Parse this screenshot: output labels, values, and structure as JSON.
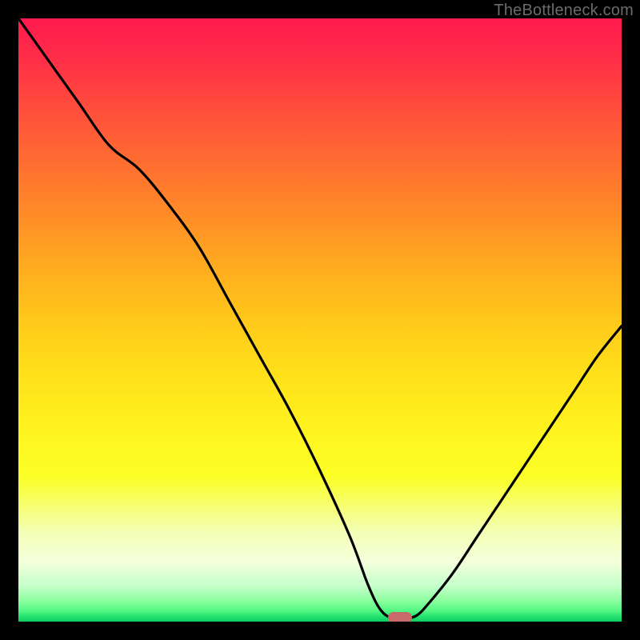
{
  "watermark": "TheBottleneck.com",
  "marker": {
    "x_pct": 63.2,
    "y_pct": 99.3,
    "color": "#c96a6a"
  },
  "chart_data": {
    "type": "line",
    "title": "",
    "xlabel": "",
    "ylabel": "",
    "xlim": [
      0,
      100
    ],
    "ylim": [
      0,
      100
    ],
    "grid": false,
    "series": [
      {
        "name": "bottleneck-curve",
        "x": [
          0,
          5,
          10,
          15,
          20,
          25,
          30,
          35,
          40,
          45,
          50,
          55,
          58,
          60,
          62,
          64,
          66,
          68,
          72,
          76,
          80,
          84,
          88,
          92,
          96,
          100
        ],
        "y": [
          100,
          93,
          86,
          79,
          75,
          69,
          62,
          53,
          44,
          35,
          25,
          14,
          6,
          2,
          0.5,
          0.5,
          1,
          3,
          8,
          14,
          20,
          26,
          32,
          38,
          44,
          49
        ]
      }
    ],
    "annotations": [
      {
        "type": "marker",
        "x": 63.2,
        "y": 0.7,
        "label": "optimal-point"
      }
    ],
    "background_gradient": {
      "orientation": "vertical",
      "stops": [
        {
          "pct": 0,
          "color": "#ff1a4e"
        },
        {
          "pct": 50,
          "color": "#ffc81a"
        },
        {
          "pct": 85,
          "color": "#f3ffb4"
        },
        {
          "pct": 100,
          "color": "#0fcf63"
        }
      ]
    }
  }
}
